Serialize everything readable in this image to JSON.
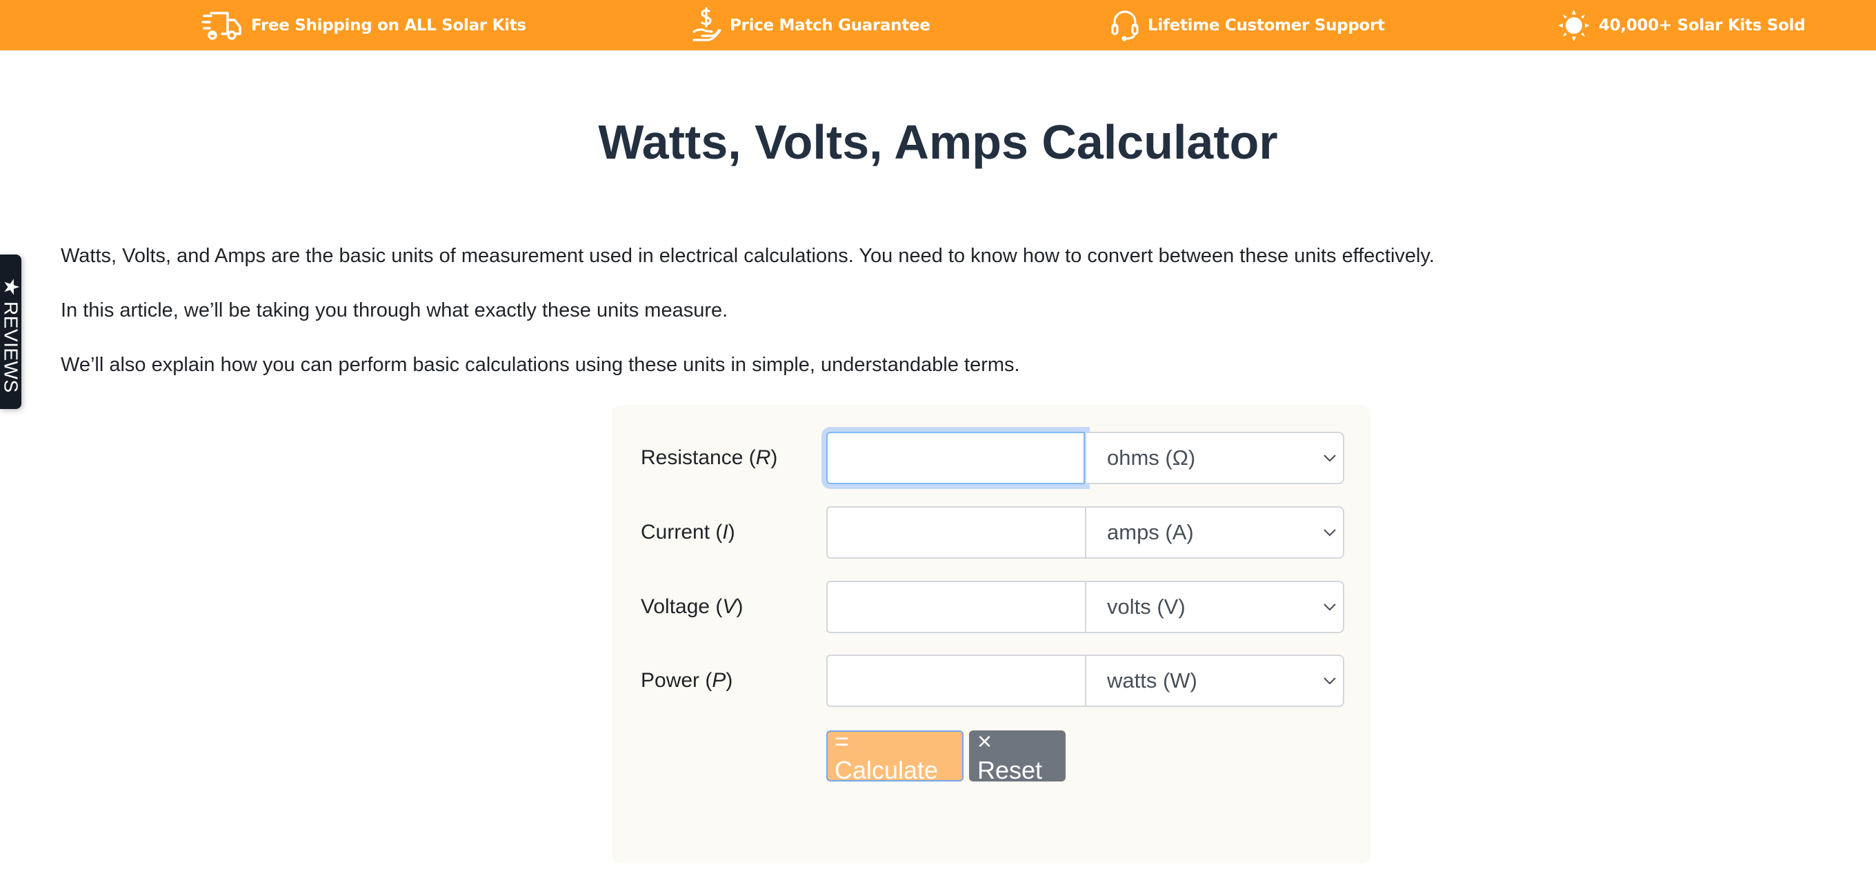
{
  "promo_bar": {
    "background": "#fe9b20",
    "items": [
      {
        "icon": "truck-icon",
        "label": "Free Shipping on ALL Solar Kits"
      },
      {
        "icon": "hand-dollar-icon",
        "label": "Price Match Guarantee"
      },
      {
        "icon": "headset-icon",
        "label": "Lifetime Customer Support"
      },
      {
        "icon": "sun-icon",
        "label": "40,000+ Solar Kits Sold"
      }
    ]
  },
  "reviews_tab": {
    "icon": "star-icon",
    "label": "REVIEWS"
  },
  "page": {
    "title": "Watts, Volts, Amps Calculator",
    "intro": [
      "Watts, Volts, and Amps are the basic units of measurement used in electrical calculations. You need to know how to convert between these units effectively.",
      "In this article, we’ll be taking you through what exactly these units measure.",
      "We’ll also explain how you can perform basic calculations using these units in simple, understandable terms."
    ]
  },
  "calculator": {
    "rows": [
      {
        "label": "Resistance",
        "symbol": "R",
        "value": "",
        "unit": "ohms (Ω)",
        "focused": true
      },
      {
        "label": "Current",
        "symbol": "I",
        "value": "",
        "unit": "amps (A)",
        "focused": false
      },
      {
        "label": "Voltage",
        "symbol": "V",
        "value": "",
        "unit": "volts (V)",
        "focused": false
      },
      {
        "label": "Power",
        "symbol": "P",
        "value": "",
        "unit": "watts (W)",
        "focused": false
      }
    ],
    "calculate_label": "= Calculate",
    "reset_label": "× Reset",
    "accent_color": "#fdbd77",
    "reset_color": "#6f757e"
  }
}
